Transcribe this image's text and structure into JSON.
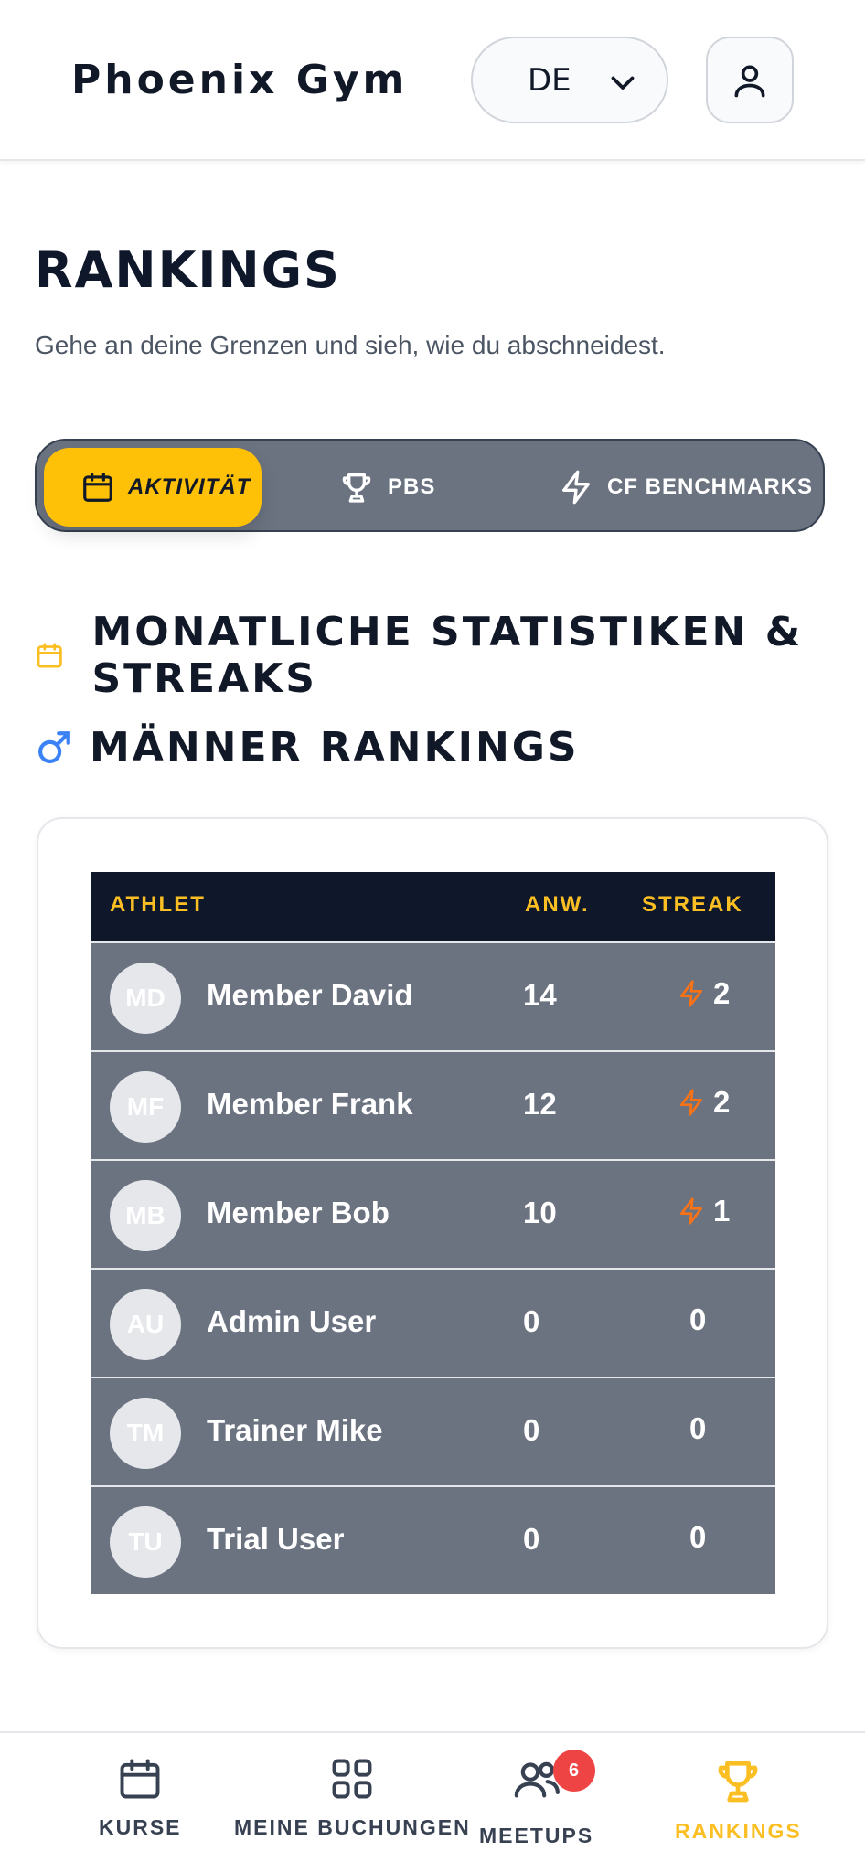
{
  "header": {
    "brand": "Phoenix Gym",
    "language": "DE"
  },
  "page": {
    "title": "RANKINGS",
    "subtitle": "Gehe an deine Grenzen und sieh, wie du abschneidest."
  },
  "tabs": [
    {
      "label": "AKTIVITÄT",
      "icon": "calendar-icon",
      "active": true
    },
    {
      "label": "PBS",
      "icon": "trophy-icon",
      "active": false
    },
    {
      "label": "CF BENCHMARKS",
      "icon": "lightning-icon",
      "active": false
    }
  ],
  "section": {
    "title": "MONATLICHE STATISTIKEN & STREAKS"
  },
  "men": {
    "title": "MÄNNER RANKINGS"
  },
  "table": {
    "headers": {
      "athlete": "ATHLET",
      "attendance": "ANW.",
      "streak": "STREAK"
    },
    "rows": [
      {
        "initials": "MD",
        "name": "Member David",
        "attendance": "14",
        "streak": "2",
        "hot": true
      },
      {
        "initials": "MF",
        "name": "Member Frank",
        "attendance": "12",
        "streak": "2",
        "hot": true
      },
      {
        "initials": "MB",
        "name": "Member Bob",
        "attendance": "10",
        "streak": "1",
        "hot": true
      },
      {
        "initials": "AU",
        "name": "Admin User",
        "attendance": "0",
        "streak": "0",
        "hot": false
      },
      {
        "initials": "TM",
        "name": "Trainer Mike",
        "attendance": "0",
        "streak": "0",
        "hot": false
      },
      {
        "initials": "TU",
        "name": "Trial User",
        "attendance": "0",
        "streak": "0",
        "hot": false
      }
    ]
  },
  "nav": {
    "items": [
      {
        "label": "KURSE",
        "icon": "calendar-icon"
      },
      {
        "label": "MEINE BUCHUNGEN",
        "icon": "grid-icon"
      },
      {
        "label": "MEETUPS",
        "icon": "users-icon",
        "badge": "6"
      },
      {
        "label": "RANKINGS",
        "icon": "trophy-icon",
        "active": true
      }
    ]
  },
  "colors": {
    "accent": "#ffc107",
    "table_header": "#0f172a",
    "row_bg": "#6b7280",
    "streak_icon": "#f97316",
    "badge": "#ef4444"
  }
}
